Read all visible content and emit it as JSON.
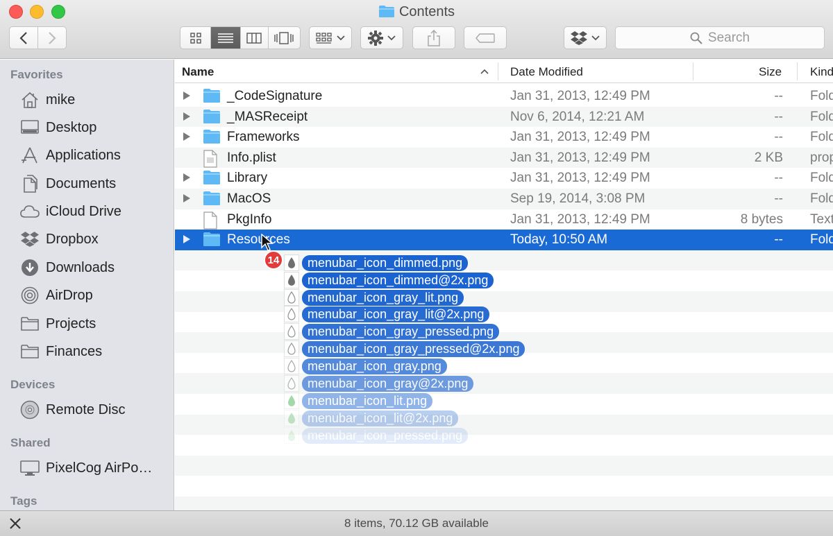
{
  "window": {
    "title": "Contents",
    "traffic_lights": [
      "close",
      "minimize",
      "zoom"
    ]
  },
  "toolbar": {
    "back_icon": "chevron-left-icon",
    "forward_icon": "chevron-right-icon",
    "view_modes": [
      "icon-view",
      "list-view",
      "column-view",
      "cover-flow-view"
    ],
    "active_view": "list-view",
    "arrange_icon": "arrange-grid-icon",
    "action_icon": "gear-icon",
    "share_icon": "share-icon",
    "tag_icon": "tag-icon",
    "dropbox_icon": "dropbox-icon",
    "search_placeholder": "Search"
  },
  "sidebar": {
    "sections": [
      {
        "title": "Favorites",
        "items": [
          {
            "label": "mike",
            "icon": "home-icon"
          },
          {
            "label": "Desktop",
            "icon": "desktop-icon"
          },
          {
            "label": "Applications",
            "icon": "applications-icon"
          },
          {
            "label": "Documents",
            "icon": "documents-icon"
          },
          {
            "label": "iCloud Drive",
            "icon": "cloud-icon"
          },
          {
            "label": "Dropbox",
            "icon": "dropbox-icon"
          },
          {
            "label": "Downloads",
            "icon": "downloads-icon"
          },
          {
            "label": "AirDrop",
            "icon": "airdrop-icon"
          },
          {
            "label": "Projects",
            "icon": "folder-icon"
          },
          {
            "label": "Finances",
            "icon": "folder-icon"
          }
        ]
      },
      {
        "title": "Devices",
        "items": [
          {
            "label": "Remote Disc",
            "icon": "disc-icon"
          }
        ]
      },
      {
        "title": "Shared",
        "items": [
          {
            "label": "PixelCog AirPo…",
            "icon": "computer-icon"
          }
        ]
      },
      {
        "title": "Tags",
        "items": []
      }
    ]
  },
  "list": {
    "columns": {
      "name": "Name",
      "date": "Date Modified",
      "size": "Size",
      "kind": "Kind"
    },
    "rows": [
      {
        "name": "_CodeSignature",
        "date": "Jan 31, 2013, 12:49 PM",
        "size": "--",
        "kind": "Folder",
        "type": "folder"
      },
      {
        "name": "_MASReceipt",
        "date": "Nov 6, 2014, 12:21 AM",
        "size": "--",
        "kind": "Folder",
        "type": "folder"
      },
      {
        "name": "Frameworks",
        "date": "Jan 31, 2013, 12:49 PM",
        "size": "--",
        "kind": "Folder",
        "type": "folder"
      },
      {
        "name": "Info.plist",
        "date": "Jan 31, 2013, 12:49 PM",
        "size": "2 KB",
        "kind": "property list",
        "type": "plist"
      },
      {
        "name": "Library",
        "date": "Jan 31, 2013, 12:49 PM",
        "size": "--",
        "kind": "Folder",
        "type": "folder"
      },
      {
        "name": "MacOS",
        "date": "Sep 19, 2014, 3:08 PM",
        "size": "--",
        "kind": "Folder",
        "type": "folder"
      },
      {
        "name": "PkgInfo",
        "date": "Jan 31, 2013, 12:49 PM",
        "size": "8 bytes",
        "kind": "TextEdit",
        "type": "file"
      },
      {
        "name": "Resources",
        "date": "Today, 10:50 AM",
        "size": "--",
        "kind": "Folder",
        "type": "folder",
        "selected": true
      }
    ]
  },
  "drag": {
    "count_badge": "14",
    "items": [
      "menubar_icon_dimmed.png",
      "menubar_icon_dimmed@2x.png",
      "menubar_icon_gray_lit.png",
      "menubar_icon_gray_lit@2x.png",
      "menubar_icon_gray_pressed.png",
      "menubar_icon_gray_pressed@2x.png",
      "menubar_icon_gray.png",
      "menubar_icon_gray@2x.png",
      "menubar_icon_lit.png",
      "menubar_icon_lit@2x.png",
      "menubar_icon_pressed.png"
    ]
  },
  "status": {
    "text": "8 items, 70.12 GB available",
    "tool_icon": "tools-icon"
  },
  "colors": {
    "selection": "#1a6ad6",
    "folder": "#5fb9f4",
    "drag_label": "#1b63d0",
    "badge": "#e33a3a"
  }
}
